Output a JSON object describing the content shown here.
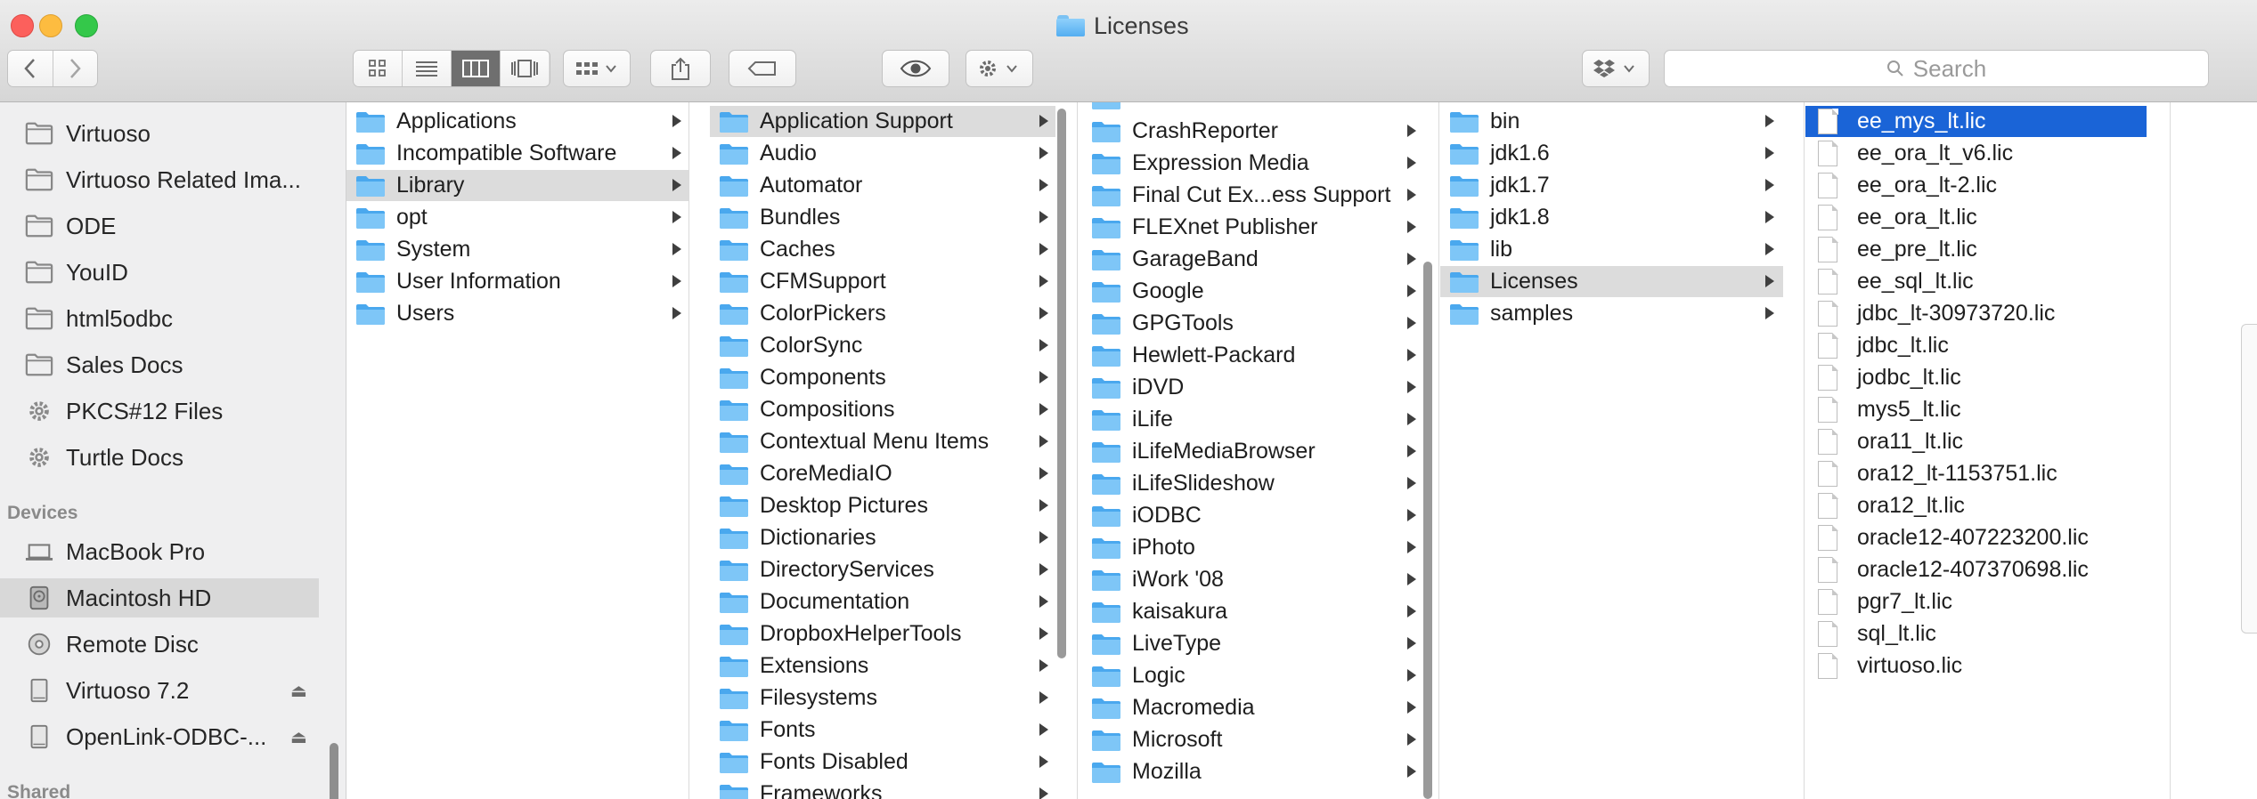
{
  "window": {
    "title": "Licenses"
  },
  "toolbar": {
    "view_modes": [
      "icon",
      "list",
      "column",
      "cover-flow"
    ],
    "active_view": "column",
    "search_placeholder": "Search"
  },
  "sidebar": {
    "items": [
      {
        "label": "Virtuoso",
        "icon": "folder-icon"
      },
      {
        "label": "Virtuoso Related Ima...",
        "icon": "folder-icon"
      },
      {
        "label": "ODE",
        "icon": "folder-icon"
      },
      {
        "label": "YouID",
        "icon": "folder-icon"
      },
      {
        "label": "html5odbc",
        "icon": "folder-icon"
      },
      {
        "label": "Sales Docs",
        "icon": "folder-icon"
      },
      {
        "label": "PKCS#12 Files",
        "icon": "gear-icon"
      },
      {
        "label": "Turtle Docs",
        "icon": "gear-icon"
      }
    ],
    "devices_heading": "Devices",
    "devices": [
      {
        "label": "MacBook Pro",
        "icon": "laptop-icon"
      },
      {
        "label": "Macintosh HD",
        "icon": "hard-drive-icon",
        "selected": true
      },
      {
        "label": "Remote Disc",
        "icon": "disc-icon"
      },
      {
        "label": "Virtuoso 7.2",
        "icon": "drive-icon",
        "ejectable": true
      },
      {
        "label": "OpenLink-ODBC-...",
        "icon": "drive-icon",
        "ejectable": true
      }
    ],
    "shared_heading": "Shared"
  },
  "columns": [
    {
      "items": [
        {
          "label": "Applications",
          "has_children": true
        },
        {
          "label": "Incompatible Software",
          "has_children": true
        },
        {
          "label": "Library",
          "has_children": true,
          "highlighted": true
        },
        {
          "label": "opt",
          "has_children": true
        },
        {
          "label": "System",
          "has_children": true
        },
        {
          "label": "User Information",
          "has_children": true
        },
        {
          "label": "Users",
          "has_children": true
        }
      ]
    },
    {
      "items": [
        {
          "label": "Application Support",
          "has_children": true,
          "highlighted": true
        },
        {
          "label": "Audio",
          "has_children": true
        },
        {
          "label": "Automator",
          "has_children": true
        },
        {
          "label": "Bundles",
          "has_children": true
        },
        {
          "label": "Caches",
          "has_children": true
        },
        {
          "label": "CFMSupport",
          "has_children": true
        },
        {
          "label": "ColorPickers",
          "has_children": true
        },
        {
          "label": "ColorSync",
          "has_children": true
        },
        {
          "label": "Components",
          "has_children": true
        },
        {
          "label": "Compositions",
          "has_children": true
        },
        {
          "label": "Contextual Menu Items",
          "has_children": true
        },
        {
          "label": "CoreMediaIO",
          "has_children": true
        },
        {
          "label": "Desktop Pictures",
          "has_children": true
        },
        {
          "label": "Dictionaries",
          "has_children": true
        },
        {
          "label": "DirectoryServices",
          "has_children": true
        },
        {
          "label": "Documentation",
          "has_children": true
        },
        {
          "label": "DropboxHelperTools",
          "has_children": true
        },
        {
          "label": "Extensions",
          "has_children": true
        },
        {
          "label": "Filesystems",
          "has_children": true
        },
        {
          "label": "Fonts",
          "has_children": true
        },
        {
          "label": "Fonts Disabled",
          "has_children": true
        },
        {
          "label": "Frameworks",
          "has_children": true
        }
      ]
    },
    {
      "items": [
        {
          "label": "CrashReporter",
          "has_children": true
        },
        {
          "label": "Expression Media",
          "has_children": true
        },
        {
          "label": "Final Cut Ex...ess Support",
          "has_children": true
        },
        {
          "label": "FLEXnet Publisher",
          "has_children": true
        },
        {
          "label": "GarageBand",
          "has_children": true
        },
        {
          "label": "Google",
          "has_children": true
        },
        {
          "label": "GPGTools",
          "has_children": true
        },
        {
          "label": "Hewlett-Packard",
          "has_children": true
        },
        {
          "label": "iDVD",
          "has_children": true
        },
        {
          "label": "iLife",
          "has_children": true
        },
        {
          "label": "iLifeMediaBrowser",
          "has_children": true
        },
        {
          "label": "iLifeSlideshow",
          "has_children": true
        },
        {
          "label": "iODBC",
          "has_children": true
        },
        {
          "label": "iPhoto",
          "has_children": true
        },
        {
          "label": "iWork '08",
          "has_children": true
        },
        {
          "label": "kaisakura",
          "has_children": true
        },
        {
          "label": "LiveType",
          "has_children": true
        },
        {
          "label": "Logic",
          "has_children": true
        },
        {
          "label": "Macromedia",
          "has_children": true
        },
        {
          "label": "Microsoft",
          "has_children": true
        },
        {
          "label": "Mozilla",
          "has_children": true
        }
      ]
    },
    {
      "items": [
        {
          "label": "bin",
          "has_children": true
        },
        {
          "label": "jdk1.6",
          "has_children": true
        },
        {
          "label": "jdk1.7",
          "has_children": true
        },
        {
          "label": "jdk1.8",
          "has_children": true
        },
        {
          "label": "lib",
          "has_children": true
        },
        {
          "label": "Licenses",
          "has_children": true,
          "highlighted": true
        },
        {
          "label": "samples",
          "has_children": true
        }
      ]
    },
    {
      "items": [
        {
          "label": "ee_mys_lt.lic",
          "selected": true
        },
        {
          "label": "ee_ora_lt_v6.lic"
        },
        {
          "label": "ee_ora_lt-2.lic"
        },
        {
          "label": "ee_ora_lt.lic"
        },
        {
          "label": "ee_pre_lt.lic"
        },
        {
          "label": "ee_sql_lt.lic"
        },
        {
          "label": "jdbc_lt-30973720.lic"
        },
        {
          "label": "jdbc_lt.lic"
        },
        {
          "label": "jodbc_lt.lic"
        },
        {
          "label": "mys5_lt.lic"
        },
        {
          "label": "ora11_lt.lic"
        },
        {
          "label": "ora12_lt-1153751.lic"
        },
        {
          "label": "ora12_lt.lic"
        },
        {
          "label": "oracle12-407223200.lic"
        },
        {
          "label": "oracle12-407370698.lic"
        },
        {
          "label": "pgr7_lt.lic"
        },
        {
          "label": "sql_lt.lic"
        },
        {
          "label": "virtuoso.lic"
        }
      ]
    }
  ],
  "colors": {
    "selection": "#1a64d7",
    "highlight": "#dcdcdc",
    "folder": "#5db4f2",
    "close": "#fc605c",
    "minimize": "#fdbc40",
    "maximize": "#34c84a"
  }
}
